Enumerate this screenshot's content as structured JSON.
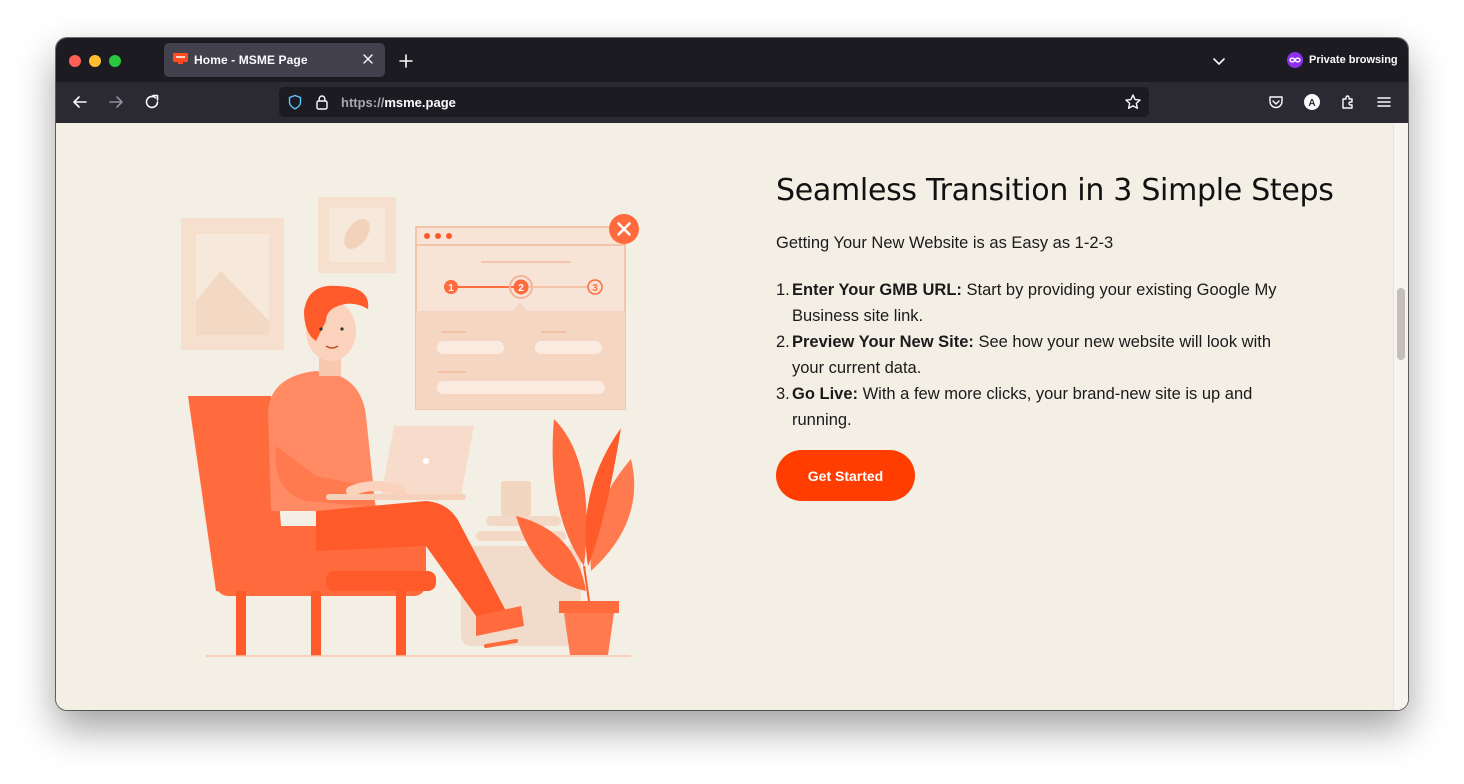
{
  "browser": {
    "tab": {
      "title": "Home - MSME Page",
      "favicon": "msme-favicon",
      "close_icon": "close-icon"
    },
    "new_tab_icon": "plus-icon",
    "list_tabs_icon": "chevron-down-icon",
    "private_label": "Private browsing",
    "url": {
      "scheme": "https://",
      "host": "msme.page"
    }
  },
  "section": {
    "heading": "Seamless Transition in 3 Simple Steps",
    "subheading": "Getting Your New Website is as Easy as 1-2-3",
    "steps": [
      {
        "num": "1.",
        "title": "Enter Your GMB URL:",
        "text": " Start by providing your existing Google My Business site link."
      },
      {
        "num": "2.",
        "title": "Preview Your New Site:",
        "text": " See how your new website will look with your current data."
      },
      {
        "num": "3.",
        "title": "Go Live:",
        "text": " With a few more clicks, your brand-new site is up and running."
      }
    ],
    "cta_label": "Get Started",
    "illustration_steps": [
      "1",
      "2",
      "3"
    ]
  },
  "colors": {
    "accent": "#ff3d00",
    "page_bg": "#f4efe5",
    "illustration": "#ff6b3d"
  }
}
